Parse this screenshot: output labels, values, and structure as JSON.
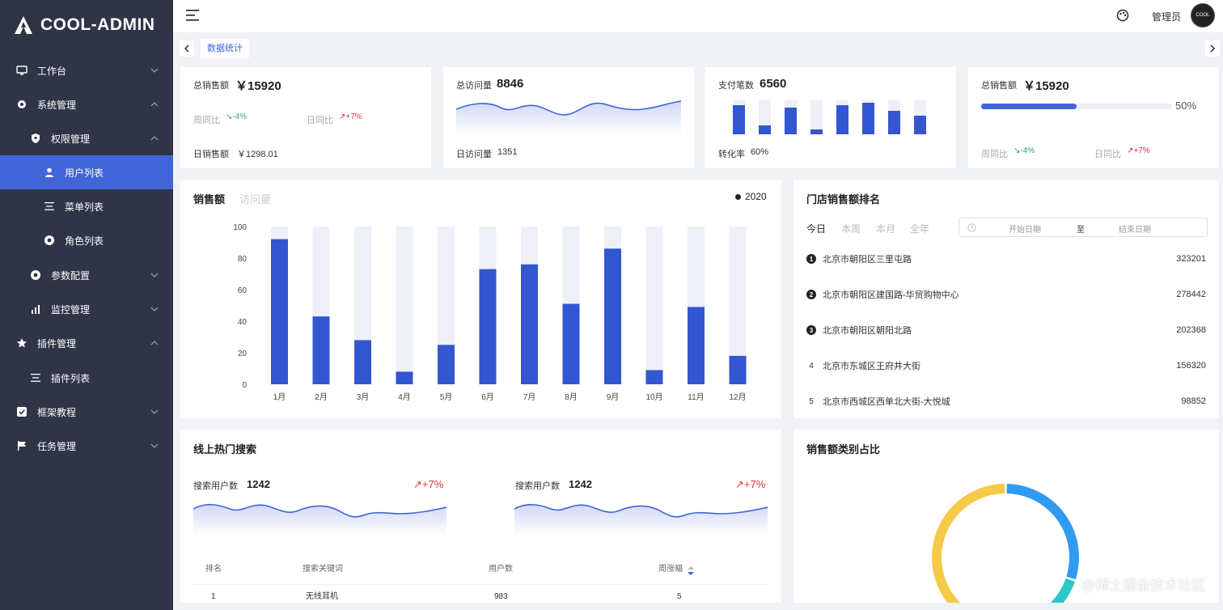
{
  "app": {
    "title": "COOL-ADMIN"
  },
  "sidebar": {
    "items": [
      {
        "label": "工作台",
        "icon": "monitor-icon",
        "arrow": "down"
      },
      {
        "label": "系统管理",
        "icon": "gear-icon",
        "arrow": "up"
      },
      {
        "label": "权限管理",
        "icon": "shield-icon",
        "arrow": "up"
      },
      {
        "label": "用户列表",
        "icon": "user-icon",
        "active": true
      },
      {
        "label": "菜单列表",
        "icon": "menu-list-icon"
      },
      {
        "label": "角色列表",
        "icon": "role-icon"
      },
      {
        "label": "参数配置",
        "icon": "settings-circle-icon",
        "arrow": "down"
      },
      {
        "label": "监控管理",
        "icon": "bar-chart-icon",
        "arrow": "down"
      },
      {
        "label": "插件管理",
        "icon": "star-icon",
        "arrow": "up"
      },
      {
        "label": "插件列表",
        "icon": "plugin-list-icon"
      },
      {
        "label": "框架教程",
        "icon": "checkbox-icon",
        "arrow": "down"
      },
      {
        "label": "任务管理",
        "icon": "flag-icon",
        "arrow": "down"
      }
    ]
  },
  "header": {
    "user_name": "管理员",
    "avatar_text": "COOL"
  },
  "tabs": {
    "active_label": "数据统计"
  },
  "stats": {
    "sales": {
      "label": "总销售额",
      "value": "￥15920",
      "week_label": "周同比",
      "week_value": "↘-4%",
      "day_label": "日同比",
      "day_value": "↗+7%",
      "daily_label": "日销售额",
      "daily_value": "￥1298.01"
    },
    "visits": {
      "label": "总访问量",
      "value": "8846",
      "daily_label": "日访问量",
      "daily_value": "1351"
    },
    "payments": {
      "label": "支付笔数",
      "value": "6560",
      "rate_label": "转化率",
      "rate_value": "60%",
      "bars": [
        0.85,
        0.25,
        0.78,
        0.15,
        0.85,
        0.92,
        0.7,
        0.55
      ]
    },
    "progress": {
      "label": "总销售额",
      "value": "￥15920",
      "percent": 50,
      "percent_text": "50%",
      "week_label": "周同比",
      "week_value": "↘-4%",
      "day_label": "日同比",
      "day_value": "↗+7%"
    }
  },
  "sales_chart": {
    "tab_sales": "销售额",
    "tab_visits": "访问量",
    "legend": "2020"
  },
  "chart_data": {
    "type": "bar",
    "categories": [
      "1月",
      "2月",
      "3月",
      "4月",
      "5月",
      "6月",
      "7月",
      "8月",
      "9月",
      "10月",
      "11月",
      "12月"
    ],
    "values": [
      92,
      43,
      28,
      8,
      25,
      73,
      76,
      51,
      86,
      9,
      49,
      18
    ],
    "background_max": 100,
    "ylim": [
      0,
      100
    ],
    "yticks": [
      0,
      20,
      40,
      60,
      80,
      100
    ],
    "legend": "2020",
    "bar_color": "#3456d1",
    "bg_color": "#eef0f7"
  },
  "store_ranking": {
    "title": "门店销售额排名",
    "periods": [
      "今日",
      "本周",
      "本月",
      "全年"
    ],
    "start_placeholder": "开始日期",
    "range_sep": "至",
    "end_placeholder": "结束日期",
    "rows": [
      {
        "rank": "1",
        "name": "北京市朝阳区三里屯路",
        "value": "323201"
      },
      {
        "rank": "2",
        "name": "北京市朝阳区建国路-华贸购物中心",
        "value": "278442"
      },
      {
        "rank": "3",
        "name": "北京市朝阳区朝阳北路",
        "value": "202368"
      },
      {
        "rank": "4",
        "name": "北京市东城区王府井大街",
        "value": "156320"
      },
      {
        "rank": "5",
        "name": "北京市西城区西单北大街-大悦城",
        "value": "98852"
      }
    ]
  },
  "hot_search": {
    "title": "线上热门搜索",
    "left": {
      "label": "搜索用户数",
      "value": "1242",
      "change": "↗+7%"
    },
    "right": {
      "label": "搜索用户数",
      "value": "1242",
      "change": "↗+7%"
    },
    "columns": [
      "排名",
      "搜索关键词",
      "用户数",
      "周涨幅"
    ],
    "rows": [
      {
        "rank": "1",
        "keyword": "无线耳机",
        "users": "983",
        "change": "5"
      }
    ]
  },
  "category": {
    "title": "销售额类别占比",
    "segments": [
      {
        "color": "#2f9cf2",
        "value": 30
      },
      {
        "color": "#2ec7c9",
        "value": 15
      },
      {
        "color": "#f7c948",
        "value": 55
      }
    ]
  },
  "watermark": "@稀土掘金技术社区",
  "colors": {
    "accent": "#4165d7",
    "sidebar": "#2f3447",
    "bar": "#3456d1"
  }
}
